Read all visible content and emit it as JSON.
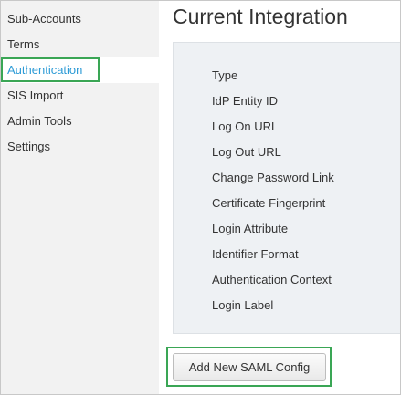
{
  "sidebar": {
    "items": [
      {
        "label": "Sub-Accounts"
      },
      {
        "label": "Terms"
      },
      {
        "label": "Authentication",
        "active": true
      },
      {
        "label": "SIS Import"
      },
      {
        "label": "Admin Tools"
      },
      {
        "label": "Settings"
      }
    ]
  },
  "main": {
    "title": "Current Integration",
    "fields": [
      "Type",
      "IdP Entity ID",
      "Log On URL",
      "Log Out URL",
      "Change Password Link",
      "Certificate Fingerprint",
      "Login Attribute",
      "Identifier Format",
      "Authentication Context",
      "Login Label"
    ],
    "add_button_label": "Add New SAML Config"
  },
  "colors": {
    "active_nav_text": "#2d9bd6",
    "highlight_border": "#3aa655",
    "sidebar_bg": "#f2f2f2",
    "panel_bg": "#eef1f4"
  }
}
